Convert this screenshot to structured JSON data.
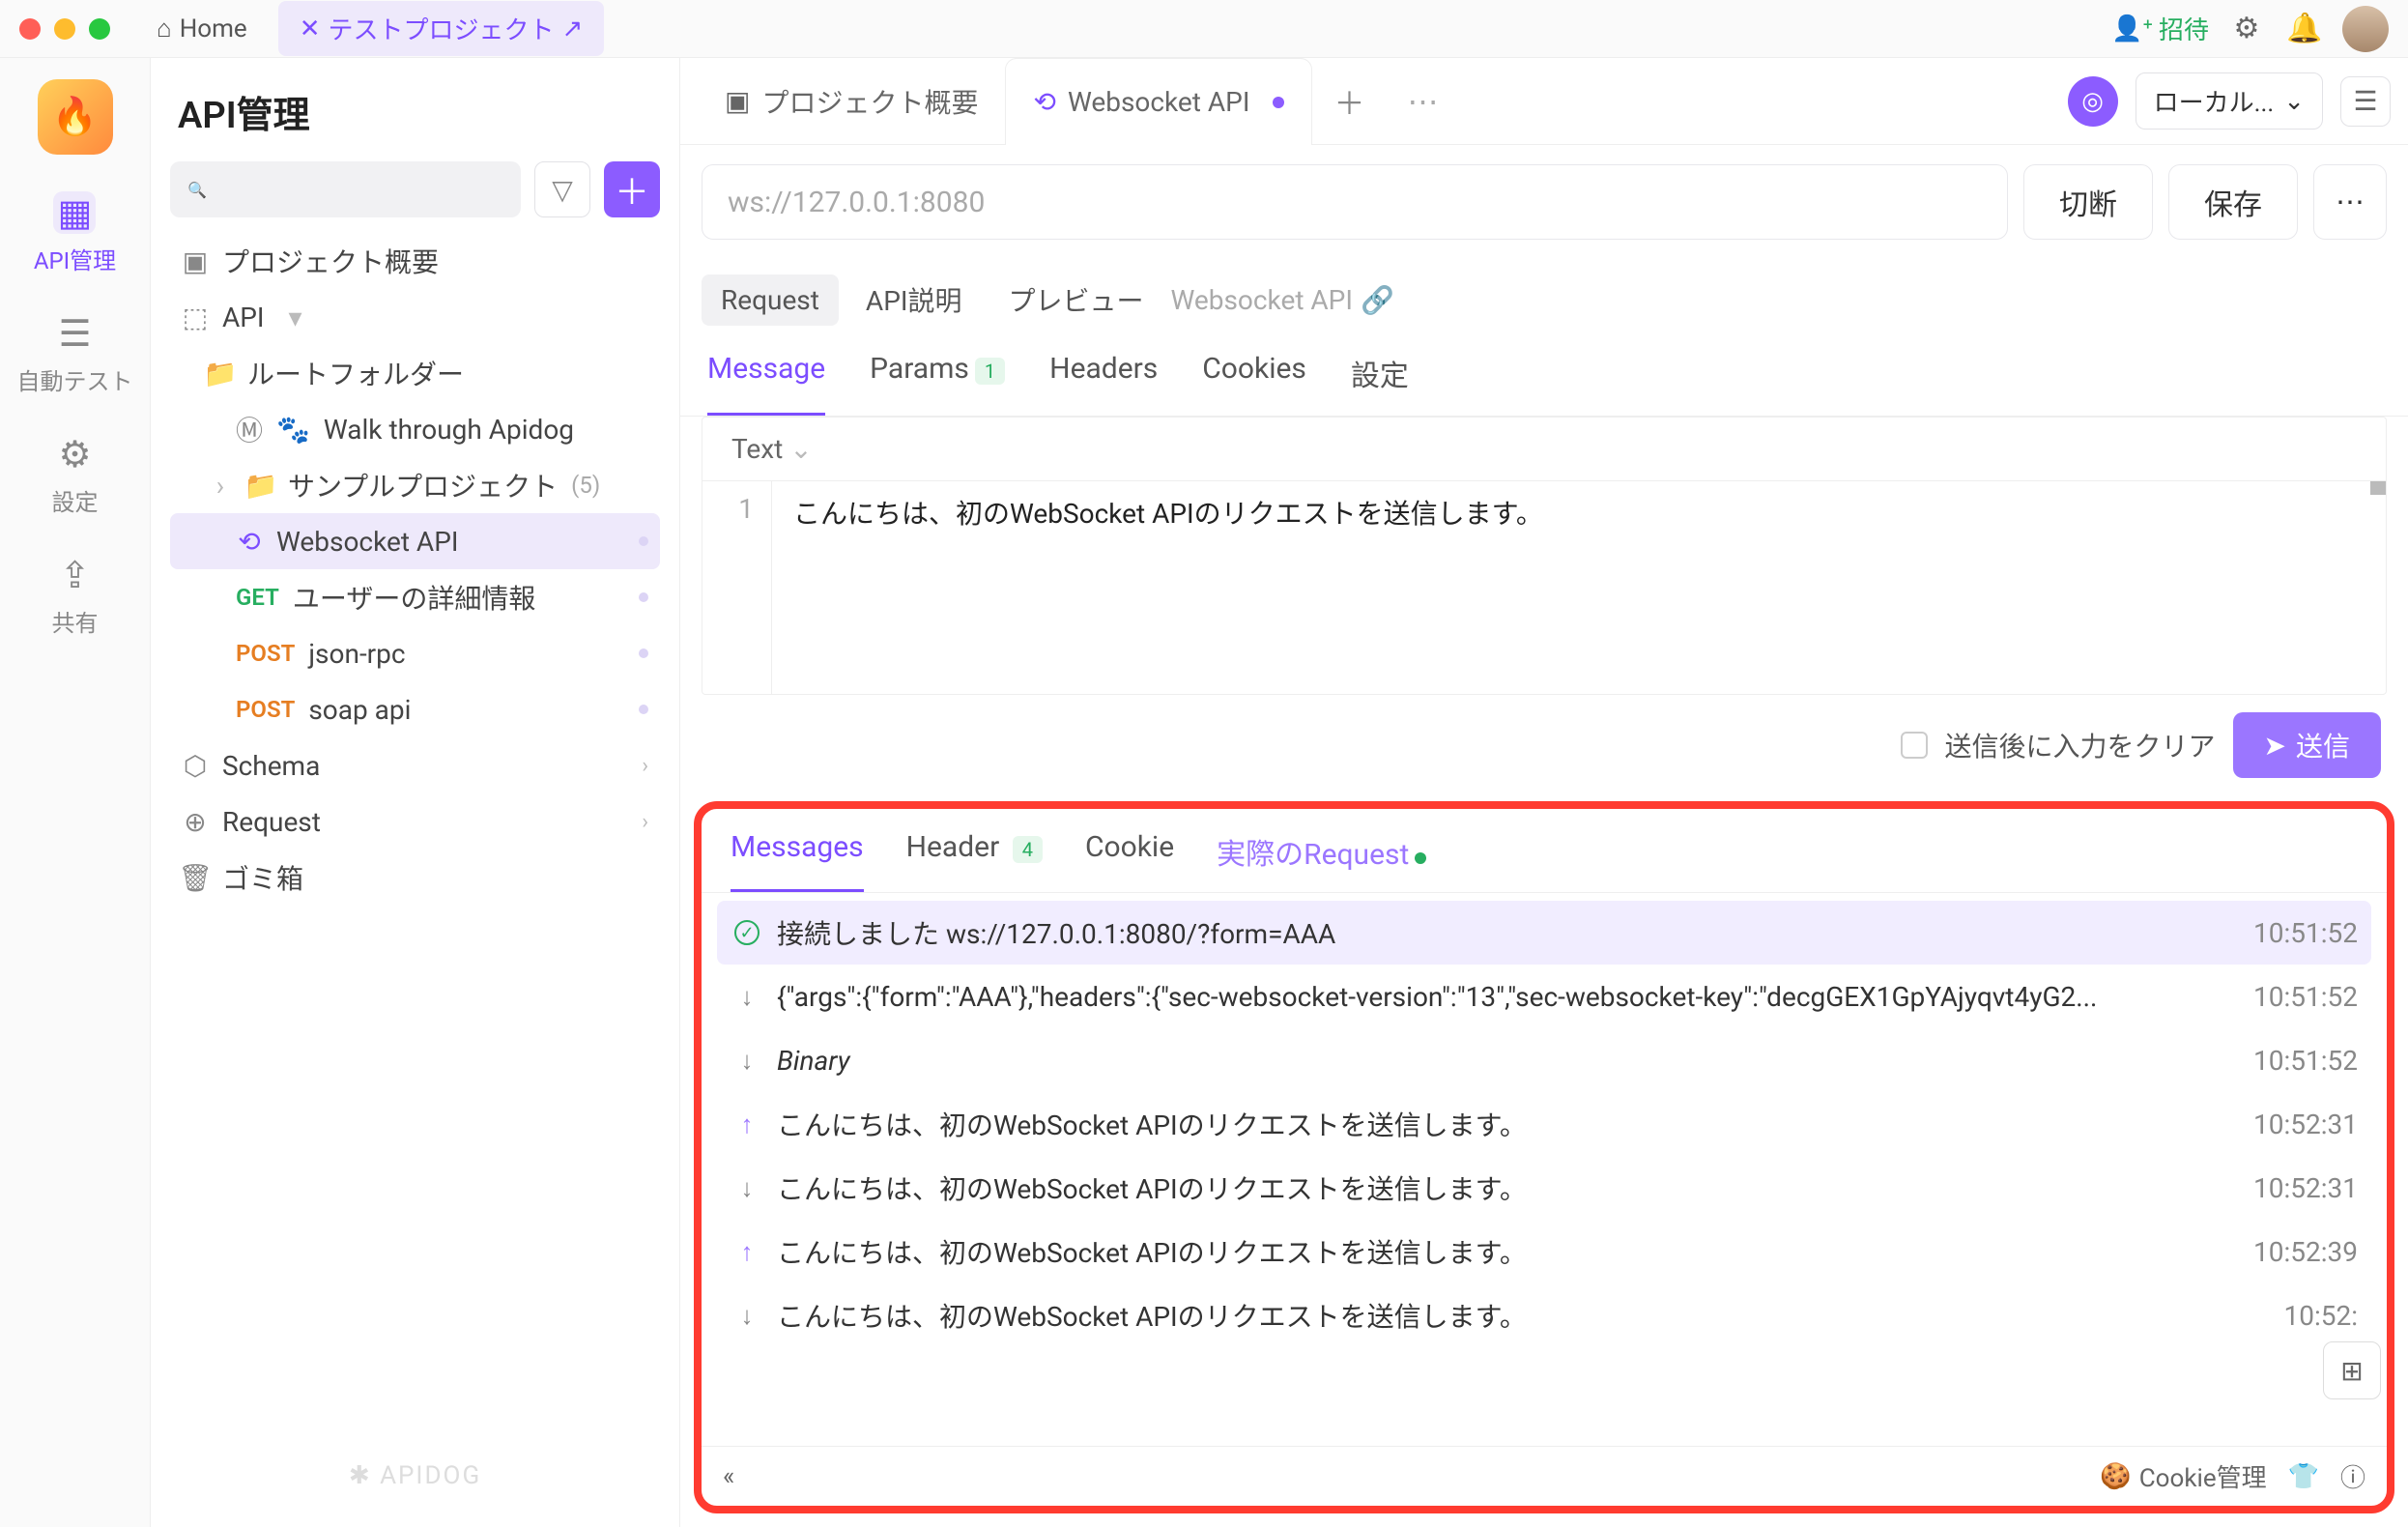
{
  "titlebar": {
    "home": "Home",
    "project_tab": "テストプロジェクト",
    "invite": "招待"
  },
  "rail": {
    "items": [
      {
        "label": "API管理",
        "icon": "api"
      },
      {
        "label": "自動テスト",
        "icon": "stack"
      },
      {
        "label": "設定",
        "icon": "gears"
      },
      {
        "label": "共有",
        "icon": "share"
      }
    ]
  },
  "sidebar": {
    "title": "API管理",
    "overview": "プロジェクト概要",
    "api_root": "API",
    "root_folder": "ルートフォルダー",
    "walk": "Walk through Apidog",
    "sample": {
      "label": "サンプルプロジェクト",
      "count": "(5)"
    },
    "ws": "Websocket API",
    "get": {
      "method": "GET",
      "label": "ユーザーの詳細情報"
    },
    "post1": {
      "method": "POST",
      "label": "json-rpc"
    },
    "post2": {
      "method": "POST",
      "label": "soap api"
    },
    "schema": "Schema",
    "request": "Request",
    "trash": "ゴミ箱",
    "brand": "✱ APIDOG"
  },
  "tabs": {
    "overview": "プロジェクト概要",
    "ws": "Websocket API",
    "env": "ローカル..."
  },
  "url": {
    "placeholder": "ws://127.0.0.1:8080",
    "disconnect": "切断",
    "save": "保存"
  },
  "subtabs": {
    "request": "Request",
    "desc": "API説明",
    "preview": "プレビュー",
    "crumb": "Websocket API"
  },
  "reqtabs": {
    "message": "Message",
    "params": "Params",
    "params_badge": "1",
    "headers": "Headers",
    "cookies": "Cookies",
    "settings": "設定"
  },
  "editor": {
    "selector": "Text",
    "line": "1",
    "content": "こんにちは、初のWebSocket APIのリクエストを送信します。"
  },
  "send": {
    "clear": "送信後に入力をクリア",
    "button": "送信"
  },
  "msgtabs": {
    "messages": "Messages",
    "header": "Header",
    "header_badge": "4",
    "cookie": "Cookie",
    "actual": "実際のRequest"
  },
  "messages": [
    {
      "type": "connected",
      "text": "接続しました ws://127.0.0.1:8080/?form=AAA",
      "time": "10:51:52"
    },
    {
      "type": "down",
      "text": "{\"args\":{\"form\":\"AAA\"},\"headers\":{\"sec-websocket-version\":\"13\",\"sec-websocket-key\":\"decgGEX1GpYAjyqvt4yG2...",
      "time": "10:51:52"
    },
    {
      "type": "down",
      "text": "Binary",
      "italic": true,
      "time": "10:51:52"
    },
    {
      "type": "up",
      "text": "こんにちは、初のWebSocket APIのリクエストを送信します。",
      "time": "10:52:31"
    },
    {
      "type": "down",
      "text": "こんにちは、初のWebSocket APIのリクエストを送信します。",
      "time": "10:52:31"
    },
    {
      "type": "up",
      "text": "こんにちは、初のWebSocket APIのリクエストを送信します。",
      "time": "10:52:39"
    },
    {
      "type": "down",
      "text": "こんにちは、初のWebSocket APIのリクエストを送信します。",
      "time": "10:52:"
    }
  ],
  "footer": {
    "cookie_mgr": "Cookie管理"
  }
}
